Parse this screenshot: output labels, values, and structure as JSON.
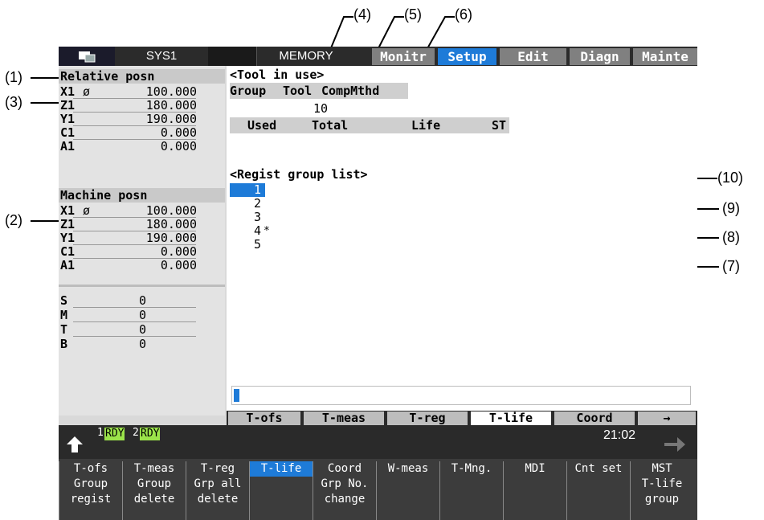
{
  "callouts": [
    "(1)",
    "(2)",
    "(3)",
    "(4)",
    "(5)",
    "(6)",
    "(7)",
    "(8)",
    "(9)",
    "(10)"
  ],
  "topbar": {
    "system": "SYS1",
    "mode": "MEMORY",
    "tabs": [
      "Monitr",
      "Setup",
      "Edit",
      "Diagn",
      "Mainte"
    ]
  },
  "left": {
    "relative_title": "Relative posn",
    "relative": [
      {
        "axis": "X1",
        "sym": "ø",
        "val": "100.000"
      },
      {
        "axis": "Z1",
        "sym": "",
        "val": "180.000"
      },
      {
        "axis": "Y1",
        "sym": "",
        "val": "190.000"
      },
      {
        "axis": "C1",
        "sym": "",
        "val": "0.000"
      },
      {
        "axis": "A1",
        "sym": "",
        "val": "0.000"
      }
    ],
    "machine_title": "Machine posn",
    "machine": [
      {
        "axis": "X1",
        "sym": "ø",
        "val": "100.000"
      },
      {
        "axis": "Z1",
        "sym": "",
        "val": "180.000"
      },
      {
        "axis": "Y1",
        "sym": "",
        "val": "190.000"
      },
      {
        "axis": "C1",
        "sym": "",
        "val": "0.000"
      },
      {
        "axis": "A1",
        "sym": "",
        "val": "0.000"
      }
    ],
    "smtb": [
      {
        "k": "S",
        "v": "0"
      },
      {
        "k": "M",
        "v": "0"
      },
      {
        "k": "T",
        "v": "0"
      },
      {
        "k": "B",
        "v": "0"
      }
    ]
  },
  "main": {
    "tool_in_use": "<Tool in use>",
    "hdr_group": "Group",
    "hdr_tool": "Tool",
    "hdr_comp": "CompMthd",
    "tool_value": "10",
    "hdr_used": "Used",
    "hdr_total": "Total",
    "hdr_life": "Life",
    "hdr_st": "ST",
    "regist_title": "<Regist group list>",
    "groups": [
      "1",
      "2",
      "3",
      "4",
      "5"
    ],
    "marker": "*"
  },
  "bottom_tabs": [
    "T-ofs",
    "T-meas",
    "T-reg",
    "T-life",
    "Coord",
    "→"
  ],
  "status": {
    "rdy1_num": "1",
    "rdy1": "RDY",
    "rdy2_num": "2",
    "rdy2": "RDY",
    "time": "21:02"
  },
  "fkeys": [
    {
      "top": "T-ofs",
      "l2": "Group",
      "l3": "regist"
    },
    {
      "top": "T-meas",
      "l2": "Group",
      "l3": "delete"
    },
    {
      "top": "T-reg",
      "l2": "Grp all",
      "l3": "delete"
    },
    {
      "top": "T-life",
      "l2": "",
      "l3": ""
    },
    {
      "top": "Coord",
      "l2": "Grp No.",
      "l3": "change"
    },
    {
      "top": "W-meas",
      "l2": "",
      "l3": ""
    },
    {
      "top": "T-Mng.",
      "l2": "",
      "l3": ""
    },
    {
      "top": "MDI",
      "l2": "",
      "l3": ""
    },
    {
      "top": "Cnt set",
      "l2": "",
      "l3": ""
    },
    {
      "top": "MST",
      "l2": "T-life",
      "l3": "group"
    }
  ],
  "colors": {
    "accent": "#1e7bd8",
    "ready": "#9be34a"
  }
}
